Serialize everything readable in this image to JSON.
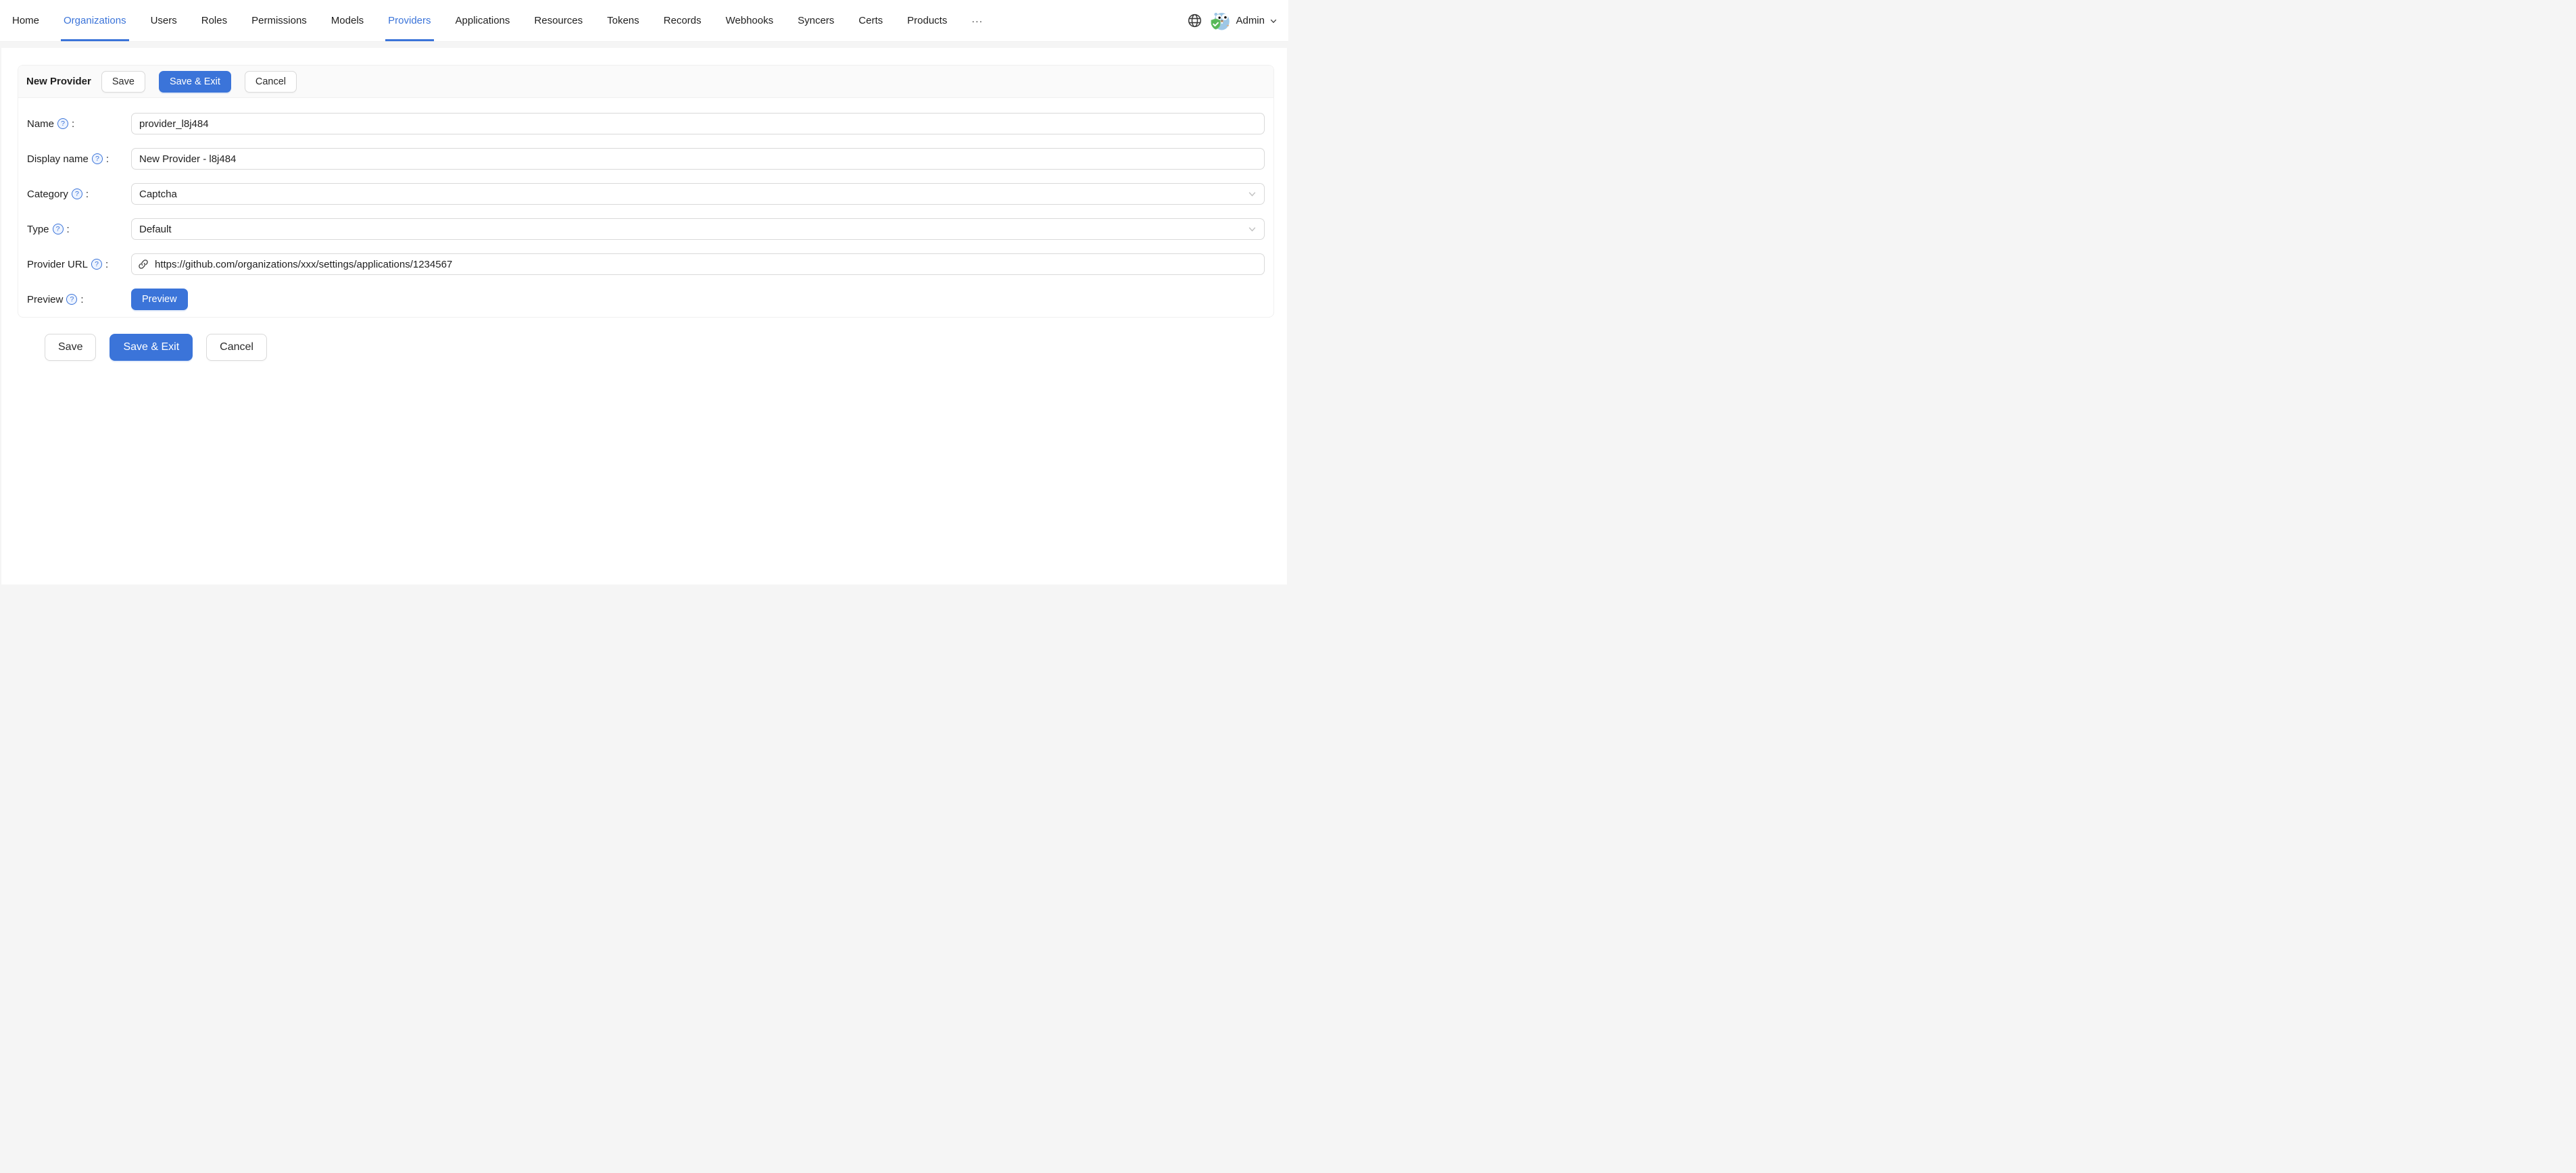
{
  "colors": {
    "accent": "#3b74d9",
    "page_bg": "#f5f5f5",
    "panel_header_bg": "#fafafa",
    "border": "#f0f0f0"
  },
  "icons": {
    "help": "?"
  },
  "nav": {
    "items": [
      {
        "label": "Home",
        "active": false
      },
      {
        "label": "Organizations",
        "active": true
      },
      {
        "label": "Users",
        "active": false
      },
      {
        "label": "Roles",
        "active": false
      },
      {
        "label": "Permissions",
        "active": false
      },
      {
        "label": "Models",
        "active": false
      },
      {
        "label": "Providers",
        "active": true
      },
      {
        "label": "Applications",
        "active": false
      },
      {
        "label": "Resources",
        "active": false
      },
      {
        "label": "Tokens",
        "active": false
      },
      {
        "label": "Records",
        "active": false
      },
      {
        "label": "Webhooks",
        "active": false
      },
      {
        "label": "Syncers",
        "active": false
      },
      {
        "label": "Certs",
        "active": false
      },
      {
        "label": "Products",
        "active": false
      },
      {
        "label": "···",
        "active": false
      }
    ],
    "user": {
      "name": "Admin"
    }
  },
  "page": {
    "title": "New Provider",
    "header_actions": {
      "save": "Save",
      "save_exit": "Save & Exit",
      "cancel": "Cancel"
    },
    "footer_actions": {
      "save": "Save",
      "save_exit": "Save & Exit",
      "cancel": "Cancel"
    },
    "form": {
      "name": {
        "label": "Name",
        "colon": ":",
        "value": "provider_l8j484"
      },
      "display_name": {
        "label": "Display name",
        "colon": ":",
        "value": "New Provider - l8j484"
      },
      "category": {
        "label": "Category",
        "colon": ":",
        "value": "Captcha"
      },
      "type": {
        "label": "Type",
        "colon": ":",
        "value": "Default"
      },
      "provider_url": {
        "label": "Provider URL",
        "colon": ":",
        "value": "https://github.com/organizations/xxx/settings/applications/1234567"
      },
      "preview": {
        "label": "Preview",
        "colon": ":",
        "button": "Preview"
      }
    }
  }
}
